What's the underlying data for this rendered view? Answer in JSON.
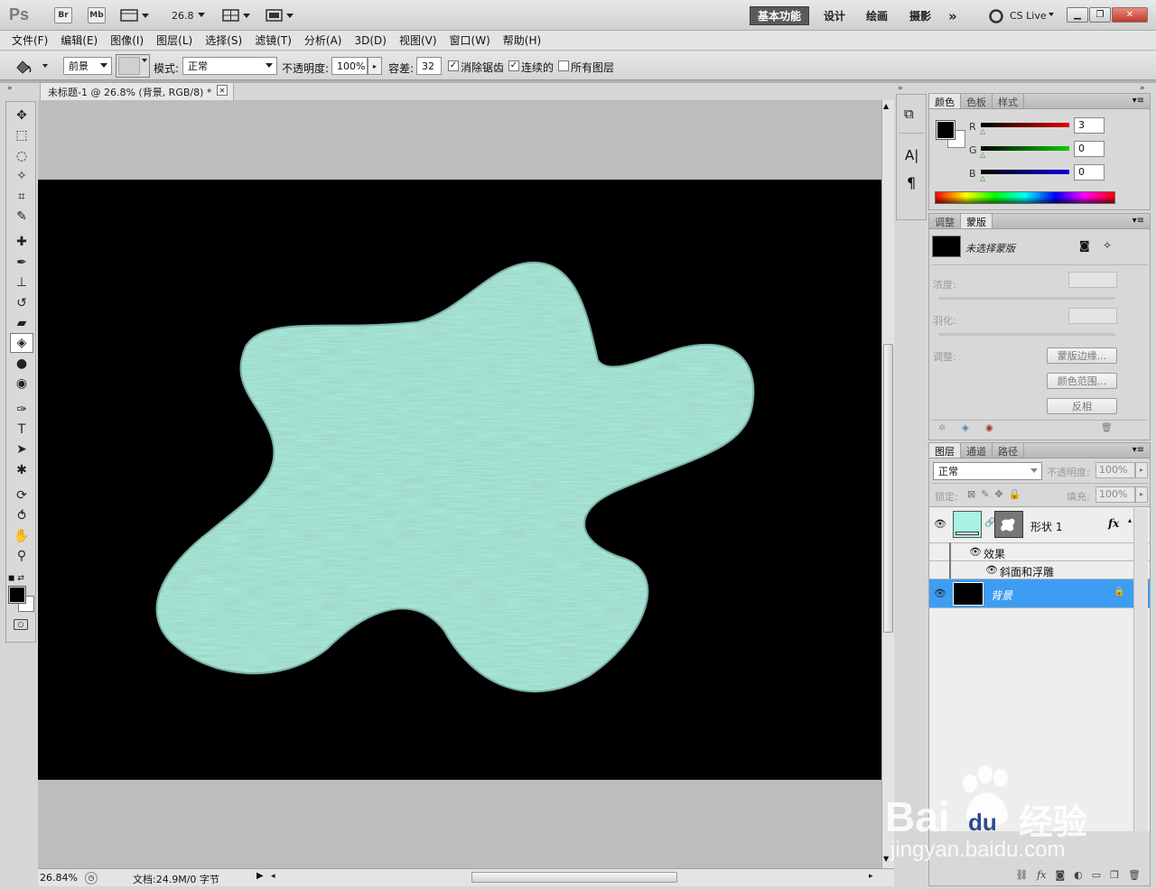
{
  "app": {
    "logo": "Ps",
    "br_label": "Br",
    "mb_label": "Mb",
    "zoom_value": "26.8",
    "workspaces": [
      "基本功能",
      "设计",
      "绘画",
      "摄影"
    ],
    "more_glyph": "»",
    "cs_live": "CS Live",
    "minimize_glyph": "▁",
    "restore_glyph": "❐",
    "close_glyph": "✕"
  },
  "menubar": [
    "文件(F)",
    "编辑(E)",
    "图像(I)",
    "图层(L)",
    "选择(S)",
    "滤镜(T)",
    "分析(A)",
    "3D(D)",
    "视图(V)",
    "窗口(W)",
    "帮助(H)"
  ],
  "options": {
    "fill_source": "前景",
    "mode_label": "模式:",
    "mode_value": "正常",
    "opacity_label": "不透明度:",
    "opacity_value": "100%",
    "tolerance_label": "容差:",
    "tolerance_value": "32",
    "antialias_label": "消除锯齿",
    "antialias_checked": true,
    "contiguous_label": "连续的",
    "contiguous_checked": true,
    "all_layers_label": "所有图层",
    "all_layers_checked": false
  },
  "document": {
    "tab_title": "未标题-1 @ 26.8% (背景, RGB/8) *",
    "close_glyph": "✕",
    "canvas_bg": "#000000",
    "shape_color": "#a8eedd",
    "pasteboard_color": "#bdbdbd"
  },
  "status": {
    "zoom": "26.84%",
    "doc_info": "文档:24.9M/0 字节"
  },
  "tools": [
    {
      "name": "move-tool",
      "glyph": "✥"
    },
    {
      "name": "marquee-tool",
      "glyph": "⬚"
    },
    {
      "name": "lasso-tool",
      "glyph": "◌"
    },
    {
      "name": "quick-select-tool",
      "glyph": "✧"
    },
    {
      "name": "crop-tool",
      "glyph": "⌗"
    },
    {
      "name": "eyedropper-tool",
      "glyph": "✎"
    },
    {
      "name": "healing-tool",
      "glyph": "✚"
    },
    {
      "name": "brush-tool",
      "glyph": "✒"
    },
    {
      "name": "stamp-tool",
      "glyph": "⊥"
    },
    {
      "name": "history-brush-tool",
      "glyph": "↺"
    },
    {
      "name": "eraser-tool",
      "glyph": "▰"
    },
    {
      "name": "paint-bucket-tool",
      "glyph": "◈"
    },
    {
      "name": "blur-tool",
      "glyph": "●"
    },
    {
      "name": "dodge-tool",
      "glyph": "◉"
    },
    {
      "name": "pen-tool",
      "glyph": "✑"
    },
    {
      "name": "type-tool",
      "glyph": "T"
    },
    {
      "name": "path-select-tool",
      "glyph": "➤"
    },
    {
      "name": "shape-tool",
      "glyph": "✱"
    },
    {
      "name": "3d-rotate-tool",
      "glyph": "⟳"
    },
    {
      "name": "3d-orbit-tool",
      "glyph": "⥀"
    },
    {
      "name": "hand-tool",
      "glyph": "✋"
    },
    {
      "name": "zoom-tool",
      "glyph": "⚲"
    }
  ],
  "mini_panels": {
    "glyphs": [
      "⧉",
      "A|",
      "¶"
    ]
  },
  "color_panel": {
    "tabs": [
      "颜色",
      "色板",
      "样式"
    ],
    "channels": [
      {
        "label": "R",
        "value": "3"
      },
      {
        "label": "G",
        "value": "0"
      },
      {
        "label": "B",
        "value": "0"
      }
    ],
    "foreground": "#030000",
    "background": "#ffffff"
  },
  "masks_panel": {
    "tabs": [
      "调整",
      "蒙版"
    ],
    "no_mask": "未选择蒙版",
    "density_label": "浓度:",
    "feather_label": "羽化:",
    "refine_label": "调整:",
    "mask_edge_btn": "蒙版边缘...",
    "color_range_btn": "颜色范围...",
    "invert_btn": "反相"
  },
  "layers_panel": {
    "tabs": [
      "图层",
      "通道",
      "路径"
    ],
    "blend_mode": "正常",
    "opacity_label": "不透明度:",
    "opacity_value": "100%",
    "lock_label": "锁定:",
    "fill_label": "填充:",
    "fill_value": "100%",
    "fx_glyph": "fx",
    "layers": [
      {
        "name": "形状 1",
        "effects_label": "效果",
        "effect": "斜面和浮雕"
      },
      {
        "name": "背景"
      }
    ]
  },
  "watermark": {
    "brand": "Bai",
    "brand2": "du",
    "cn": "经验",
    "url": "jingyan.baidu.com"
  }
}
